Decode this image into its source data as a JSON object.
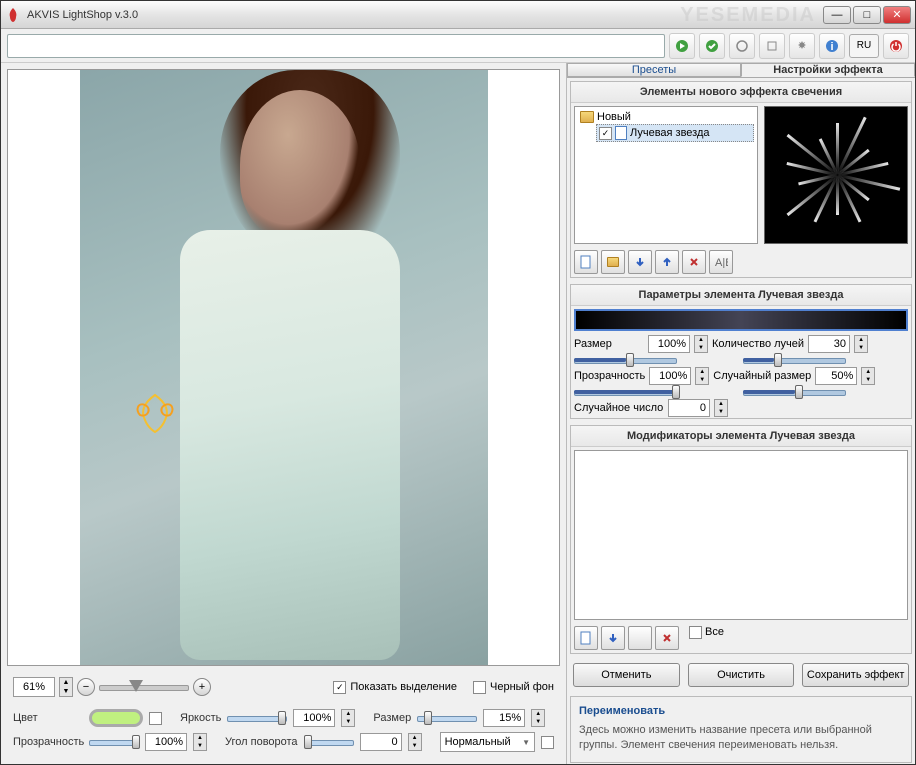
{
  "window": {
    "title": "AKVIS LightShop v.3.0"
  },
  "watermark": "YESEMEDIA",
  "toolbar": {
    "lang": "RU"
  },
  "zoom": {
    "value": "61%",
    "show_selection_label": "Показать выделение",
    "black_bg_label": "Черный фон"
  },
  "bottom": {
    "color_label": "Цвет",
    "brightness_label": "Яркость",
    "brightness_value": "100%",
    "size_label": "Размер",
    "size_value": "15%",
    "opacity_label": "Прозрачность",
    "opacity_value": "100%",
    "angle_label": "Угол поворота",
    "angle_value": "0",
    "blend_label": "Нормальный"
  },
  "tabs": {
    "presets": "Пресеты",
    "settings": "Настройки эффекта"
  },
  "elements": {
    "title": "Элементы нового эффекта свечения",
    "root": "Новый",
    "item": "Лучевая звезда"
  },
  "params": {
    "title": "Параметры элемента Лучевая звезда",
    "size_label": "Размер",
    "size_value": "100%",
    "rays_label": "Количество лучей",
    "rays_value": "30",
    "opacity_label": "Прозрачность",
    "opacity_value": "100%",
    "random_size_label": "Случайный размер",
    "random_size_value": "50%",
    "seed_label": "Случайное число",
    "seed_value": "0"
  },
  "mods": {
    "title": "Модификаторы элемента Лучевая звезда",
    "all_label": "Все"
  },
  "buttons": {
    "cancel": "Отменить",
    "clear": "Очистить",
    "save": "Сохранить эффект"
  },
  "help": {
    "title": "Переименовать",
    "text": "Здесь можно изменить название пресета или выбранной группы. Элемент свечения переименовать нельзя."
  }
}
